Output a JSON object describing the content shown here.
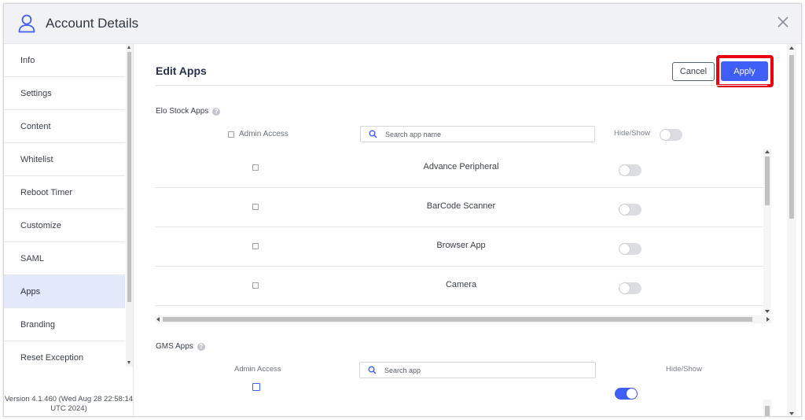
{
  "window": {
    "title": "Account Details",
    "close_label": "×"
  },
  "sidebar": {
    "items": [
      {
        "label": "Info",
        "active": false
      },
      {
        "label": "Settings",
        "active": false
      },
      {
        "label": "Content",
        "active": false
      },
      {
        "label": "Whitelist",
        "active": false
      },
      {
        "label": "Reboot Timer",
        "active": false
      },
      {
        "label": "Customize",
        "active": false
      },
      {
        "label": "SAML",
        "active": false
      },
      {
        "label": "Apps",
        "active": true
      },
      {
        "label": "Branding",
        "active": false
      },
      {
        "label": "Reset Exception",
        "active": false
      }
    ],
    "version": "Version 4.1.460 (Wed Aug 28 22:58:14 UTC 2024)"
  },
  "main": {
    "heading": "Edit Apps",
    "cancel_label": "Cancel",
    "apply_label": "Apply",
    "elo_section": {
      "label": "Elo Stock Apps",
      "admin_access_label": "Admin Access",
      "search_placeholder": "Search app name",
      "hide_show_label": "Hide/Show",
      "header_toggle_on": false,
      "apps": [
        {
          "name": "Advance Peripheral",
          "admin": false,
          "visible": false
        },
        {
          "name": "BarCode Scanner",
          "admin": false,
          "visible": false
        },
        {
          "name": "Browser App",
          "admin": false,
          "visible": false
        },
        {
          "name": "Camera",
          "admin": false,
          "visible": false
        }
      ]
    },
    "gms_section": {
      "label": "GMS Apps",
      "admin_access_label": "Admin Access",
      "search_placeholder": "Search app",
      "hide_show_label": "Hide/Show",
      "header_toggle_on": true
    }
  },
  "colors": {
    "accent": "#3f5ef5",
    "highlight": "#e8000f",
    "active_nav": "#e3e8fb"
  }
}
